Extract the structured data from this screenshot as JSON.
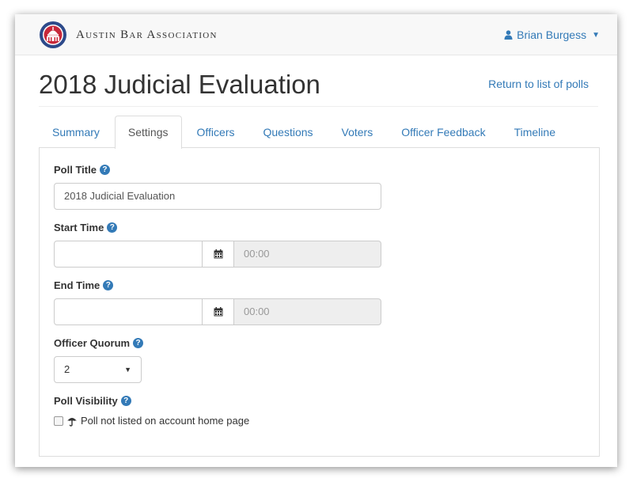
{
  "navbar": {
    "brand": "Austin Bar Association",
    "user_name": "Brian Burgess",
    "colors": {
      "link": "#337ab7",
      "navbar_bg": "#f8f8f8"
    }
  },
  "header": {
    "title": "2018 Judicial Evaluation",
    "return_link": "Return to list of polls"
  },
  "tabs": [
    {
      "label": "Summary"
    },
    {
      "label": "Settings"
    },
    {
      "label": "Officers"
    },
    {
      "label": "Questions"
    },
    {
      "label": "Voters"
    },
    {
      "label": "Officer Feedback"
    },
    {
      "label": "Timeline"
    }
  ],
  "active_tab": "Settings",
  "form": {
    "poll_title": {
      "label": "Poll Title",
      "value": "2018 Judicial Evaluation"
    },
    "start_time": {
      "label": "Start Time",
      "date_value": "",
      "time_placeholder": "00:00"
    },
    "end_time": {
      "label": "End Time",
      "date_value": "",
      "time_placeholder": "00:00"
    },
    "officer_quorum": {
      "label": "Officer Quorum",
      "selected": "2"
    },
    "poll_visibility": {
      "label": "Poll Visibility",
      "checkbox_label": "Poll not listed on account home page",
      "checked": false
    }
  },
  "icons": {
    "user": "user-icon",
    "help": "question-circle-icon",
    "calendar": "calendar-icon",
    "umbrella": "umbrella-icon"
  }
}
